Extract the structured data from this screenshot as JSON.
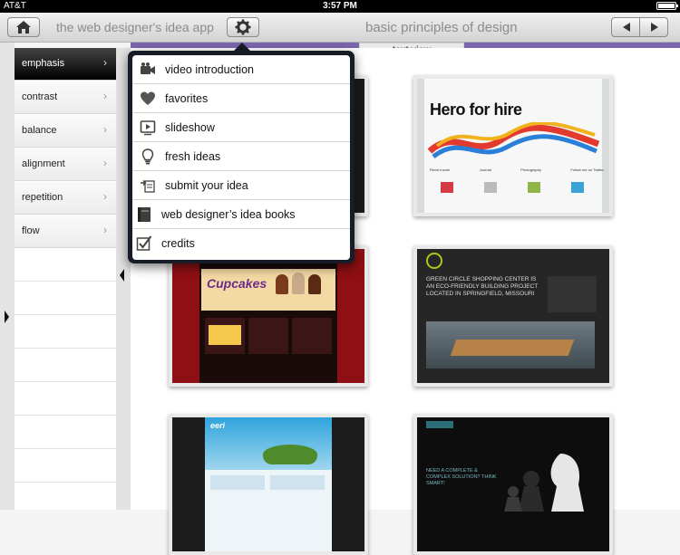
{
  "status_bar": {
    "carrier": "AT&T",
    "time": "3:57 PM"
  },
  "nav": {
    "app_title": "the web designer's idea app",
    "page_title": "basic principles of design",
    "home_icon": "home-icon",
    "gear_icon": "gear-icon",
    "prev_icon": "arrow-left-icon",
    "next_icon": "arrow-right-icon"
  },
  "view_tab": {
    "label": "text view"
  },
  "sidebar": {
    "items": [
      {
        "label": "emphasis",
        "active": true
      },
      {
        "label": "contrast"
      },
      {
        "label": "balance"
      },
      {
        "label": "alignment"
      },
      {
        "label": "repetition"
      },
      {
        "label": "flow"
      }
    ]
  },
  "menu": {
    "items": [
      {
        "label": "video introduction",
        "icon": "video-camera-icon"
      },
      {
        "label": "favorites",
        "icon": "heart-icon"
      },
      {
        "label": "slideshow",
        "icon": "play-icon"
      },
      {
        "label": "fresh ideas",
        "icon": "lightbulb-icon"
      },
      {
        "label": "submit your idea",
        "icon": "submit-icon"
      },
      {
        "label": "web designer’s idea books",
        "icon": "book-icon"
      },
      {
        "label": "credits",
        "icon": "checkbox-icon"
      }
    ]
  },
  "thumbnails": [
    {
      "title": "Hero for hire",
      "columns": [
        "Recent work",
        "Journal",
        "Photography",
        "Follow me on Twitter"
      ]
    },
    {
      "title": "Cupcakes"
    },
    {
      "title": "GREEN CIRCLE SHOPPING CENTER IS AN ECO-FRIENDLY BUILDING PROJECT LOCATED IN SPRINGFIELD, MISSOURI"
    },
    {
      "title": "eeri"
    },
    {
      "title": "NEED A COMPLETE & COMPLEX SOLUTION? THINK SMART!"
    }
  ],
  "colors": {
    "accent": "#7b65ad",
    "popover": "#171d28",
    "active_item": "#000000"
  }
}
